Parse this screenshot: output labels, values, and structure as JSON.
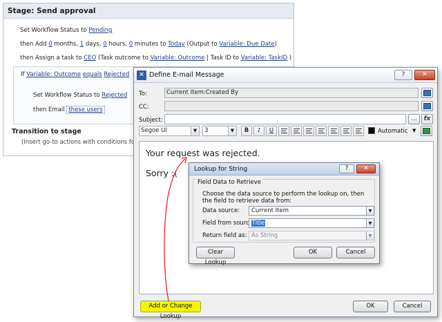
{
  "workflow": {
    "stage_title": "Stage: Send approval",
    "line1": {
      "prefix": "Set Workflow Status to ",
      "status": "Pending"
    },
    "line2": {
      "t1": "then Add ",
      "months_val": "0",
      "t2": " months, ",
      "days_val": "1",
      "t3": " days, ",
      "hours_val": "0",
      "t4": " hours, ",
      "minutes_val": "0",
      "t5": " minutes to ",
      "today": "Today",
      "t6": " (Output to ",
      "output_var": "Variable: Due Date",
      "t7": ")"
    },
    "line3": {
      "t1": "then Assign a task to ",
      "assignee": "CEO",
      "t2": " (Task outcome to ",
      "outcome_var": "Variable: Outcome",
      "t3": " | Task ID to ",
      "taskid_var": "Variable: TaskID",
      "t4": " )"
    },
    "if_block": {
      "if_word": "If ",
      "variable": "Variable: Outcome",
      "op": "equals",
      "value": "Rejected",
      "set_prefix": "Set Workflow Status to ",
      "set_status": "Rejected",
      "email_prefix": "then Email ",
      "email_target": "these users"
    },
    "transition_title": "Transition to stage",
    "transition_desc": "(Insert go-to actions with conditions for tra"
  },
  "email_dialog": {
    "title": "Define E-mail Message",
    "help_glyph": "?",
    "close_glyph": "✕",
    "to_label": "To:",
    "to_value": "Current Item:Created By",
    "cc_label": "CC:",
    "cc_value": "",
    "subject_label": "Subject:",
    "subject_value": "",
    "ellipsis": "...",
    "fx": "fx",
    "font_name": "Segoe UI",
    "font_size": "3",
    "bold": "B",
    "italic": "I",
    "underline": "U",
    "color_label": "Automatic",
    "body_line1": "Your request was rejected.",
    "body_line2": "Sorry :(",
    "lookup_button": "Add or Change Lookup",
    "ok": "OK",
    "cancel": "Cancel",
    "highlight_color": "#f5f500"
  },
  "lookup_dialog": {
    "title": "Lookup for String",
    "help_glyph": "?",
    "close_glyph": "✕",
    "group_label": "Field Data to Retrieve",
    "description": "Choose the data source to perform the lookup on, then the field to retrieve data from:",
    "data_source_label": "Data source:",
    "data_source_value": "Current Item",
    "field_label": "Field from source:",
    "field_value": "Title",
    "return_label": "Return field as:",
    "return_value": "As String",
    "clear": "Clear Lookup",
    "ok": "OK",
    "cancel": "Cancel"
  },
  "annotation": {
    "arrow_color": "#e8141e"
  }
}
